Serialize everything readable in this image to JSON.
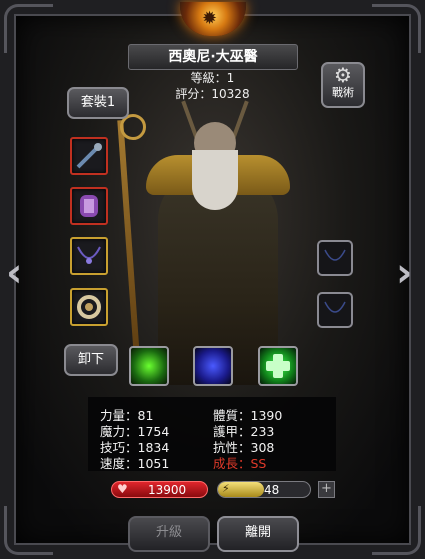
{
  "hero": {
    "name": "西奧尼·大巫醫",
    "level_text": "等級：1",
    "score_text": "評分：10328"
  },
  "buttons": {
    "outfit": "套裝1",
    "tactics": "戰術",
    "unequip": "卸下",
    "upgrade": "升級",
    "leave": "離開"
  },
  "stats": {
    "left": [
      "力量：81",
      "魔力：1754",
      "技巧：1834",
      "速度：1051"
    ],
    "right": [
      "體質：1390",
      "護甲：233",
      "抗性：308",
      "成長：SS"
    ]
  },
  "resources": {
    "health": "13900",
    "energy": "48",
    "health_color": "#c0141a",
    "energy_color": "#c9b227"
  },
  "icons": {
    "emblem": "emblem-icon",
    "gear": "gear-icon",
    "nav_left": "chevron-left-icon",
    "nav_right": "chevron-right-icon",
    "heart": "heart-icon",
    "lightning": "lightning-icon",
    "plus": "plus-icon"
  }
}
